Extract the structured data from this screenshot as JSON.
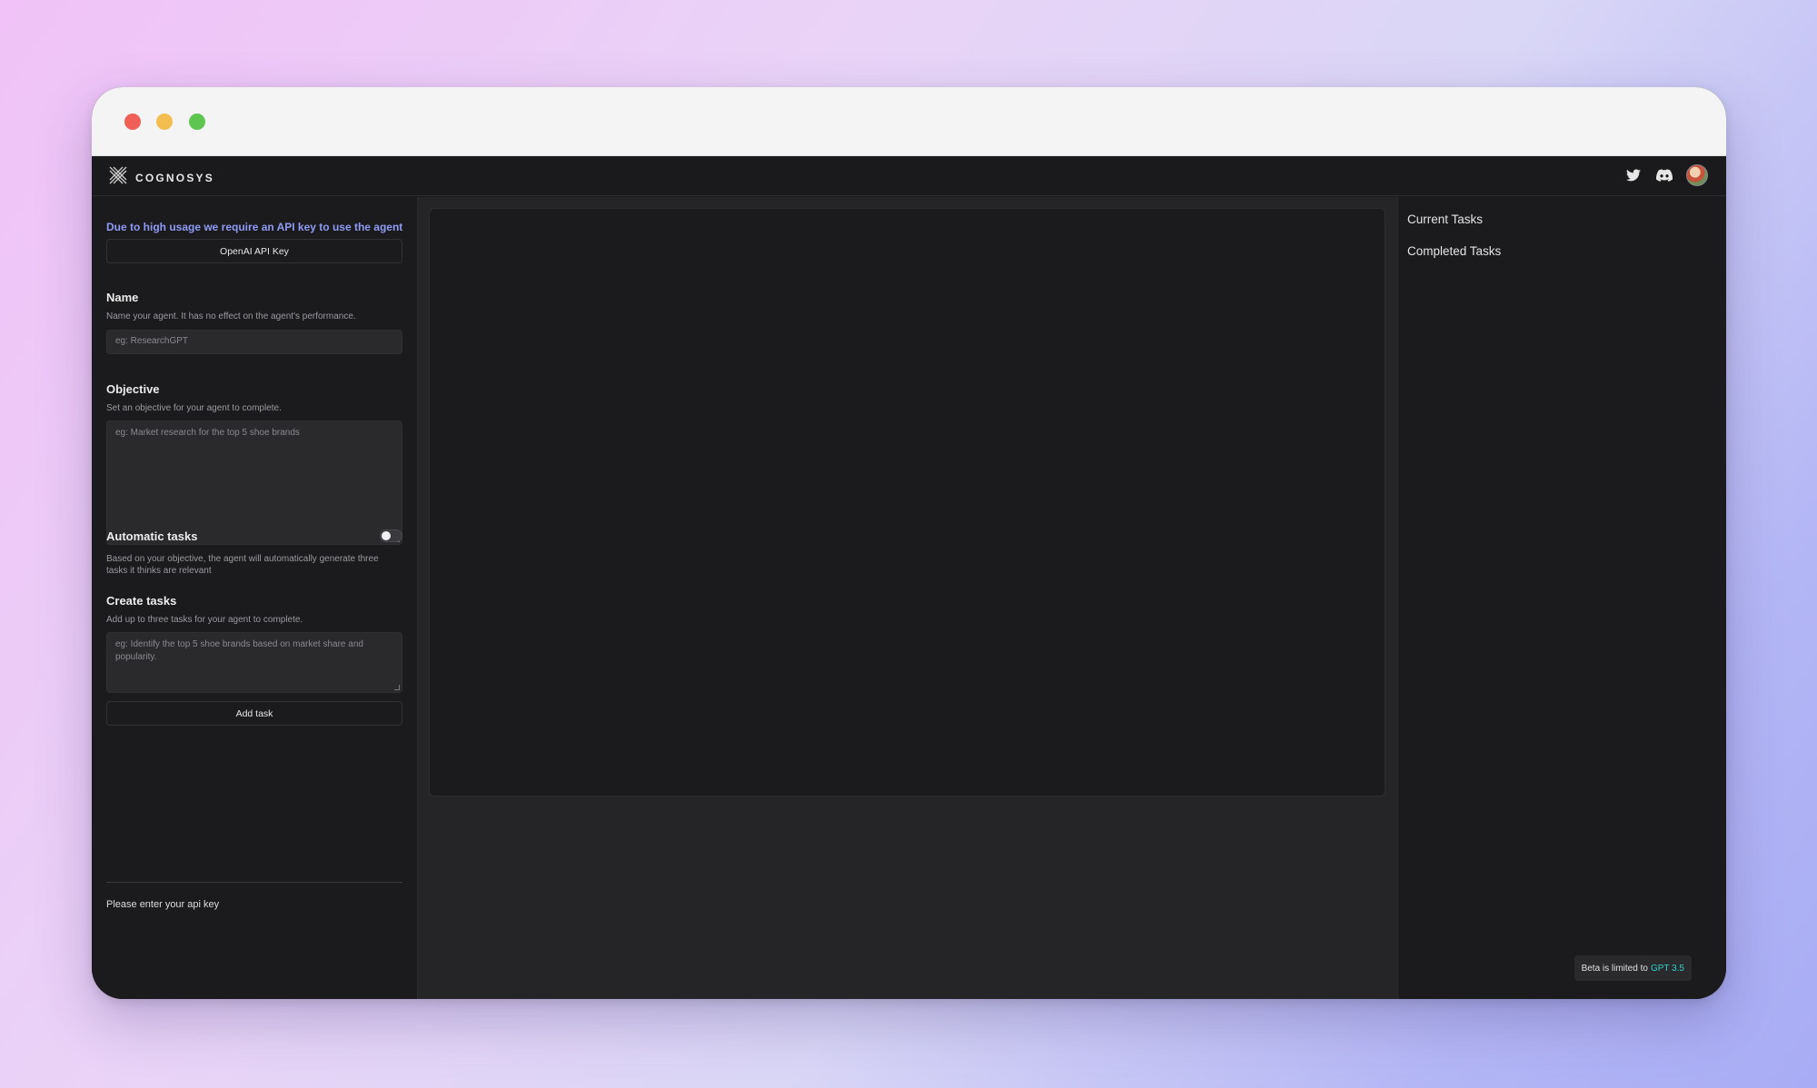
{
  "app": {
    "brand": "COGNOSYS"
  },
  "left_panel": {
    "api_warning": "Due to high usage we require an API key to use the agent",
    "api_key_button": "OpenAI API Key",
    "name": {
      "heading": "Name",
      "description": "Name your agent. It has no effect on the agent's performance.",
      "placeholder": "eg: ResearchGPT"
    },
    "objective": {
      "heading": "Objective",
      "description": "Set an objective for your agent to complete.",
      "placeholder": "eg: Market research for the top 5 shoe brands"
    },
    "automatic_tasks": {
      "heading": "Automatic tasks",
      "description": "Based on your objective, the agent will automatically generate three tasks it thinks are relevant",
      "enabled": false
    },
    "create_tasks": {
      "heading": "Create tasks",
      "description": "Add up to three tasks for your agent to complete.",
      "placeholder": "eg: Identify the top 5 shoe brands based on market share and popularity.",
      "add_button": "Add task"
    },
    "status_note": "Please enter your api key"
  },
  "right_panel": {
    "current_tasks": "Current Tasks",
    "completed_tasks": "Completed Tasks",
    "beta_prefix": "Beta is limited to",
    "beta_model": "GPT 3.5"
  },
  "colors": {
    "accent": "#8e9bf5",
    "beta_highlight": "#2fd3c7",
    "background": "#1b1b1d"
  },
  "icons": {
    "brand": "cognosys-logo-icon",
    "twitter": "twitter-icon",
    "discord": "discord-icon",
    "avatar": "user-avatar"
  }
}
